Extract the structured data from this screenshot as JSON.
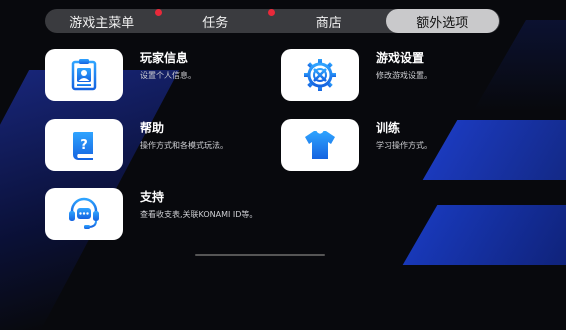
{
  "tabs": [
    {
      "label": "游戏主菜单",
      "badge": true
    },
    {
      "label": "任务",
      "badge": true
    },
    {
      "label": "商店",
      "badge": false
    },
    {
      "label": "额外选项",
      "badge": false,
      "active": true
    }
  ],
  "items": [
    {
      "title": "玩家信息",
      "desc": "设置个人信息。",
      "icon": "player-info-icon"
    },
    {
      "title": "游戏设置",
      "desc": "修改游戏设置。",
      "icon": "settings-gear-icon"
    },
    {
      "title": "帮助",
      "desc": "操作方式和各模式玩法。",
      "icon": "help-book-icon"
    },
    {
      "title": "训练",
      "desc": "学习操作方式。",
      "icon": "jersey-icon"
    },
    {
      "title": "支持",
      "desc": "查看收支表,关联KONAMI ID等。",
      "icon": "headset-support-icon"
    }
  ],
  "colors": {
    "accent": "#1a7cf0",
    "badge": "#e8293a",
    "tab_active": "#c9c9cb"
  }
}
